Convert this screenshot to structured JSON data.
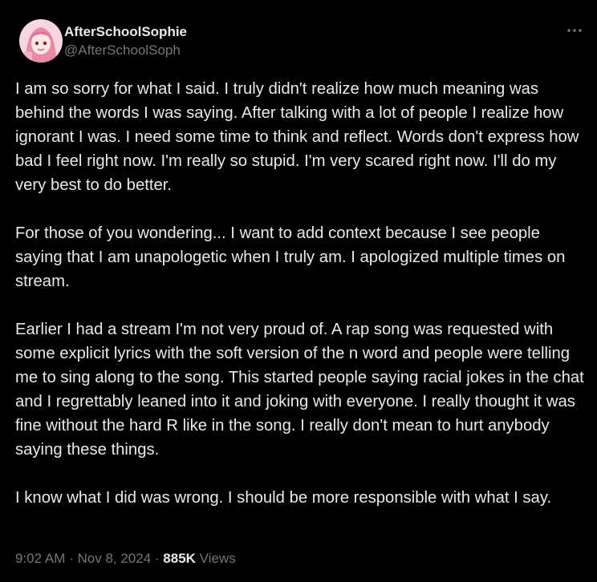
{
  "author": {
    "display_name": "AfterSchoolSophie",
    "handle": "@AfterSchoolSoph"
  },
  "post": {
    "paragraphs": [
      "I am so sorry for what I said.  I truly didn't realize how much meaning was behind the words I was saying.  After talking with a lot of people I realize how ignorant I was.  I need some time to think and reflect.  Words don't express how bad I feel right now.  I'm really so stupid.  I'm very scared right now.  I'll do my very best to do better.",
      "For those of you wondering...  I want to add context because I see people saying that I am unapologetic when I truly am.  I apologized multiple times on stream.",
      "Earlier I had a stream I'm not very proud of.  A rap song was requested with some explicit lyrics with the soft version of the n word and people were telling me to sing along to the song.  This started people saying racial jokes in the chat and I regrettably leaned into it and joking with everyone.  I really thought it was fine without the hard R like in the song.  I really don't mean to hurt anybody saying these things.",
      "I know what I did was wrong.   I should be more responsible with what I say."
    ]
  },
  "meta": {
    "time": "9:02 AM",
    "separator": " · ",
    "date": "Nov 8, 2024",
    "views_count": "885K",
    "views_label": "Views"
  },
  "icons": {
    "more": "more-horizontal-icon",
    "avatar": "avatar-anime-girl"
  },
  "colors": {
    "background": "#000000",
    "primary_text": "#e7e9ea",
    "secondary_text": "#71767b"
  }
}
